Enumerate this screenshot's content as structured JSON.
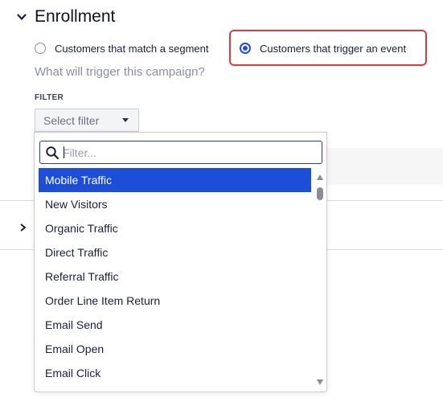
{
  "section": {
    "title": "Enrollment",
    "collapse_icon": "chevron-down-icon"
  },
  "enrollment": {
    "options": [
      {
        "label": "Customers that match a segment",
        "selected": false
      },
      {
        "label": "Customers that trigger an event",
        "selected": true
      }
    ],
    "question": "What will trigger this campaign?"
  },
  "filter": {
    "label": "FILTER",
    "select_placeholder": "Select filter",
    "dropdown_icon": "caret-down-icon"
  },
  "dropdown": {
    "search_placeholder": "Filter...",
    "search_value": "",
    "search_icon": "search-icon",
    "items": [
      "Mobile Traffic",
      "New Visitors",
      "Organic Traffic",
      "Direct Traffic",
      "Referral Traffic",
      "Order Line Item Return",
      "Email Send",
      "Email Open",
      "Email Click"
    ],
    "selected_index": 0
  },
  "collapsed_section": {
    "expand_icon": "chevron-right-icon"
  },
  "colors": {
    "accent": "#1d4ed8",
    "highlight_border": "#e0383b",
    "muted_text": "#8c8f9b"
  }
}
